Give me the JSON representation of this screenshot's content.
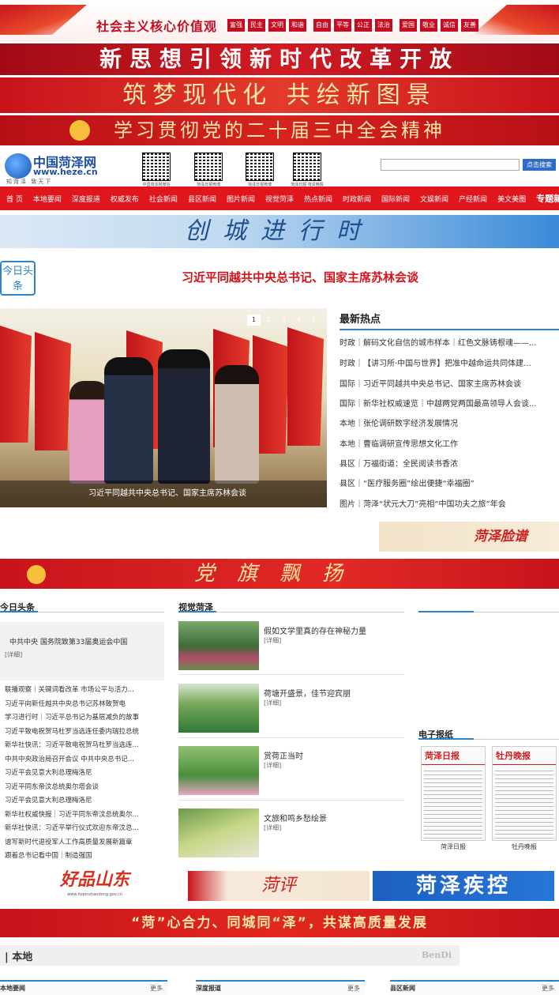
{
  "banner_values": {
    "title": "社会主义核心价值观",
    "tags": [
      "富强",
      "民主",
      "文明",
      "和谐",
      "自由",
      "平等",
      "公正",
      "法治",
      "爱国",
      "敬业",
      "诚信",
      "友善"
    ]
  },
  "banner_slogan1": "新思想引领新时代改革开放",
  "banner_slogan2": "筑梦现代化  共绘新图景",
  "banner_slogan3": "学习贯彻党的二十届三中全会精神",
  "logo": {
    "name": "中国菏泽网",
    "url": "www.heze.cn",
    "motto": "知菏泽 致天下"
  },
  "qr_labels": [
    "中国菏泽网微信",
    "菏泽日报微博",
    "菏泽日报微博",
    "菏泽日报·菏泽晚报"
  ],
  "search": {
    "placeholder": "",
    "button": "点击搜索"
  },
  "nav": [
    "首 页",
    "本地要闻",
    "深度报道",
    "权威发布",
    "社会新闻",
    "县区新闻",
    "图片新闻",
    "视觉菏泽",
    "热点新闻",
    "时政新闻",
    "国际新闻",
    "文娱新闻",
    "产经新闻",
    "美文美图",
    "专题新闻"
  ],
  "chuangcheng": "创城进行时",
  "today_badge": "今日头条",
  "headline": "习近平同越共中央总书记、国家主席苏林会谈",
  "slideshow": {
    "pages": [
      "1",
      "2",
      "3",
      "4",
      "5"
    ],
    "caption": "习近平同越共中央总书记、国家主席苏林会谈"
  },
  "hot": {
    "title": "最新热点",
    "items": [
      {
        "cat": "时政",
        "text": "解码文化自信的城市样本｜红色文脉铸根魂——..."
      },
      {
        "cat": "时政",
        "text": "【讲习所·中国与世界】把准中越命运共同体建..."
      },
      {
        "cat": "国际",
        "text": "习近平同越共中央总书记、国家主席苏林会谈"
      },
      {
        "cat": "国际",
        "text": "新华社权威速览｜中越两党两国最高领导人会谈..."
      },
      {
        "cat": "本地",
        "text": "张伦调研数字经济发展情况"
      },
      {
        "cat": "本地",
        "text": "曹临调研宣传思想文化工作"
      },
      {
        "cat": "县区",
        "text": "万福街道：全民阅读书香浓"
      },
      {
        "cat": "县区",
        "text": "“医疗服务圈”绘出便捷“幸福圈”"
      },
      {
        "cat": "图片",
        "text": "菏泽“状元大刀”亮相“中国功夫之旅”年会"
      }
    ]
  },
  "heze_lianpu": "菏泽脸谱",
  "party_banner": "党旗飘扬",
  "today_top": {
    "title": "今日头条",
    "lead": "中共中央 国务院致第33届奥运会中国",
    "detail": "[详细]",
    "items": [
      "联播观察｜关键词看改革 市场公平与活力...",
      "习近平向新任越共中央总书记苏林致贺电",
      "学习进行时｜习近平总书记为基层减负的故事",
      "习近平致电祝贺马杜罗当选连任委内瑞拉总统",
      "新华社快讯：习近平致电祝贺马杜罗当选连...",
      "中共中央政治局召开会议 中共中央总书记...",
      "习近平会见意大利总理梅洛尼",
      "习近平同东帝汶总统奥尔塔会谈",
      "习近平会见意大利总理梅洛尼",
      "新华社权威快报｜习近平同东帝汶总统奥尔...",
      "新华社快讯：习近平举行仪式欢迎东帝汶总...",
      "谱写新时代退役军人工作高质量发展新篇章",
      "跟着总书记看中国｜制造强国"
    ]
  },
  "visual": {
    "title": "视觉菏泽",
    "items": [
      {
        "title": "假如文学里真的存在神秘力量",
        "detail": "[详细]"
      },
      {
        "title": "荷塘开盛景，佳节迎宾朋",
        "detail": "[详细]"
      },
      {
        "title": "赏荷正当时",
        "detail": "[详细]"
      },
      {
        "title": "文旅和鸣乡愁绘景",
        "detail": "[详细]"
      }
    ]
  },
  "epaper": {
    "title": "电子报纸",
    "papers": [
      {
        "mast": "菏泽日报",
        "label": "菏泽日报"
      },
      {
        "mast": "牡丹晚报",
        "label": "牡丹晚报"
      }
    ]
  },
  "ads": {
    "haopin": "好品山东",
    "haopin_url": "www.hopinshandong.gov.cn",
    "heping": "菏评",
    "jikong": "菏泽疾控"
  },
  "bottom_slogan": "“菏”心合力、同城同“泽”，共谋高质量发展",
  "bendi": {
    "title": "| 本地",
    "en": "BenDi"
  },
  "subtabs": [
    {
      "label": "本地要闻",
      "more": "更多"
    },
    {
      "label": "深度报道",
      "more": "更多"
    },
    {
      "label": "县区新闻",
      "more": "更多"
    }
  ],
  "colors": {
    "brand_red": "#e0161d",
    "accent_blue": "#2d83c8",
    "logo_blue": "#1d4fa3"
  }
}
